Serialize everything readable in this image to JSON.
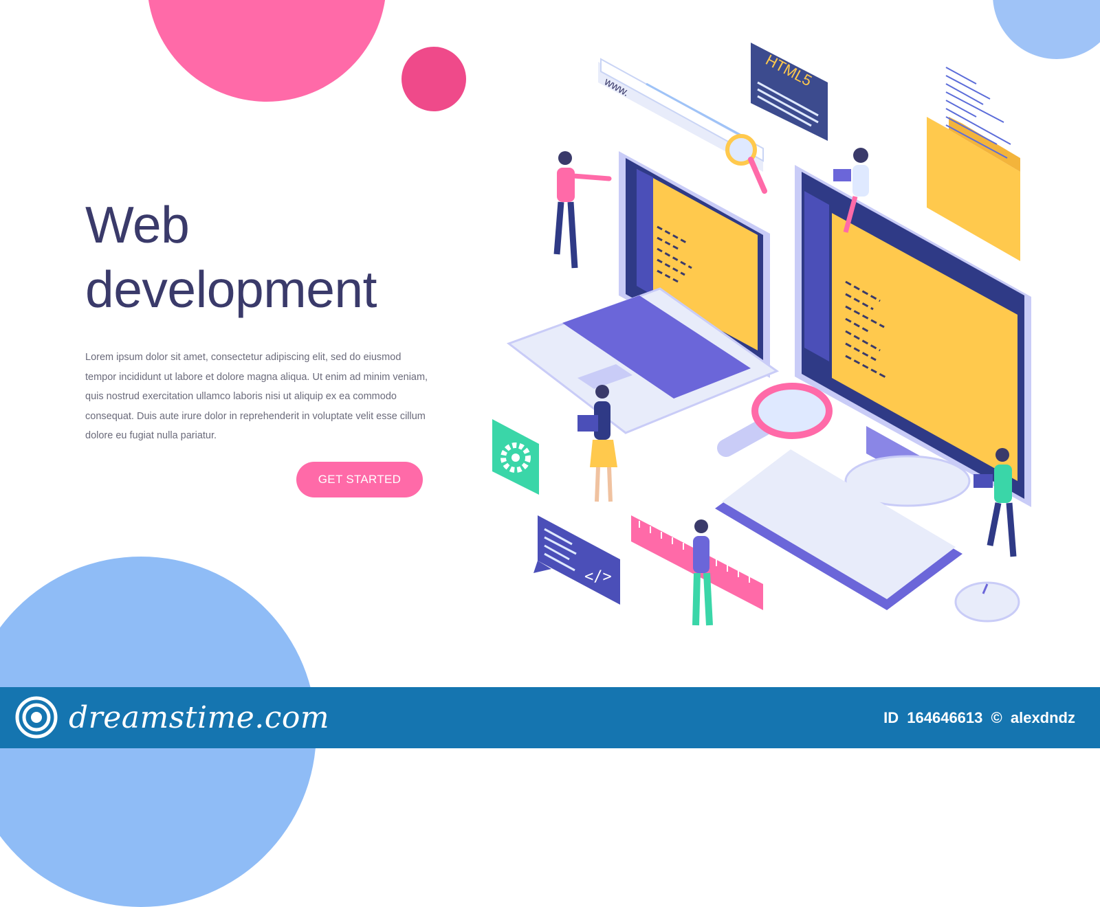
{
  "hero": {
    "title_line1": "Web",
    "title_line2": "development",
    "body": "Lorem ipsum dolor sit amet, consectetur adipiscing elit, sed do eiusmod tempor incididunt ut labore et dolore magna aliqua. Ut enim ad minim veniam, quis nostrud exercitation ullamco laboris nisi ut aliquip ex ea commodo consequat. Duis aute irure dolor in reprehenderit in voluptate velit esse cillum dolore eu fugiat nulla pariatur.",
    "cta_label": "GET STARTED"
  },
  "illustration": {
    "url_bar_text": "www.",
    "badge_text": "HTML5",
    "icons": [
      "laptop-icon",
      "monitor-icon",
      "keyboard-icon",
      "mouse-icon",
      "magnifier-icon",
      "gear-icon",
      "code-icon",
      "folder-icon",
      "ruler-icon"
    ]
  },
  "footer": {
    "brand": "dreamstime.com",
    "id_label": "ID",
    "id_value": "164646613",
    "copyright": "©",
    "author": "alexdndz"
  },
  "colors": {
    "pink": "#ff6aa8",
    "pink_dark": "#ef4a8a",
    "blue_light": "#8fbcf6",
    "navy_text": "#3a3a6a",
    "purple": "#6b66d9",
    "yellow": "#ffc94d",
    "footer_blue": "#1575b0"
  }
}
